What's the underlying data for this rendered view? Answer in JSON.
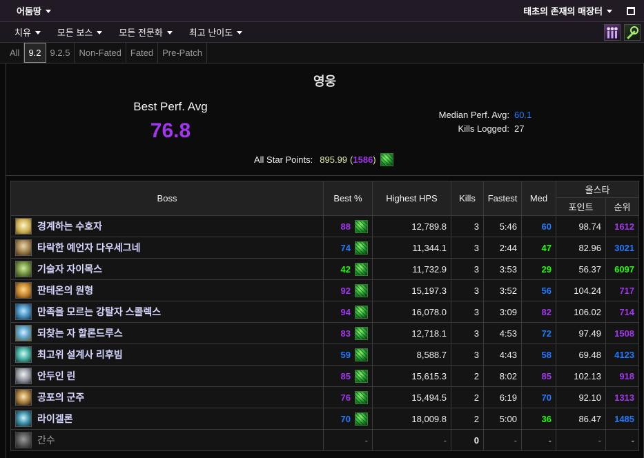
{
  "palette": {
    "epic": "#a335ee",
    "rare": "#1f7bff",
    "uncommon": "#1eff00",
    "common": "#9d9d9d"
  },
  "nav": {
    "expansion": {
      "label": "어둠땅",
      "icon": "caret-down-icon"
    },
    "zone": {
      "label": "태초의 존재의 매장터",
      "icon": "caret-down-icon"
    },
    "window_icon": "expand-icon",
    "filters": [
      {
        "label": "치유",
        "icon": "caret-down-icon"
      },
      {
        "label": "모든 보스",
        "icon": "caret-down-icon"
      },
      {
        "label": "모든 전문화",
        "icon": "caret-down-icon"
      },
      {
        "label": "최고 난이도",
        "icon": "caret-down-icon"
      }
    ],
    "tool_icons": [
      "character-icon",
      "key-icon"
    ]
  },
  "tabs": [
    {
      "label": "All"
    },
    {
      "label": "9.2",
      "active": true
    },
    {
      "label": "9.2.5"
    },
    {
      "label": "Non-Fated"
    },
    {
      "label": "Fated"
    },
    {
      "label": "Pre-Patch"
    }
  ],
  "summary": {
    "difficulty": "영웅",
    "best_perf_label": "Best Perf. Avg",
    "best_perf_value": "76.8",
    "median_label": "Median Perf. Avg:",
    "median_value": "60.1",
    "kills_label": "Kills Logged:",
    "kills_value": "27",
    "allstar_label": "All Star Points:",
    "allstar_points": "895.99",
    "allstar_rank": "1586",
    "allstar_rank_color": "#a335ee",
    "spec_icon": "spec-icon"
  },
  "table": {
    "headers": {
      "boss": "Boss",
      "best": "Best %",
      "hps": "Highest HPS",
      "kills": "Kills",
      "fastest": "Fastest",
      "med": "Med",
      "allstar": "올스타",
      "points": "포인트",
      "rank": "순위"
    },
    "rows": [
      {
        "boss": "경계하는 수호자",
        "best": 88,
        "hps": "12,789.8",
        "kills": "3",
        "fastest": "5:46",
        "med": 60,
        "points": "98.74",
        "rank": "1612",
        "rank_color": "#a335ee"
      },
      {
        "boss": "타락한 예언자 다우세그네",
        "best": 74,
        "hps": "11,344.1",
        "kills": "3",
        "fastest": "2:44",
        "med": 47,
        "points": "82.96",
        "rank": "3021",
        "rank_color": "#1f7bff"
      },
      {
        "boss": "기술자 자이목스",
        "best": 42,
        "hps": "11,732.9",
        "kills": "3",
        "fastest": "3:53",
        "med": 29,
        "points": "56.37",
        "rank": "6097",
        "rank_color": "#1eff00"
      },
      {
        "boss": "판테온의 원형",
        "best": 92,
        "hps": "15,197.3",
        "kills": "3",
        "fastest": "3:52",
        "med": 56,
        "points": "104.24",
        "rank": "717",
        "rank_color": "#a335ee"
      },
      {
        "boss": "만족을 모르는 강탈자 스콜렉스",
        "best": 94,
        "hps": "16,078.0",
        "kills": "3",
        "fastest": "3:09",
        "med": 82,
        "points": "106.02",
        "rank": "714",
        "rank_color": "#a335ee"
      },
      {
        "boss": "되찾는 자 할론드루스",
        "best": 83,
        "hps": "12,718.1",
        "kills": "3",
        "fastest": "4:53",
        "med": 72,
        "points": "97.49",
        "rank": "1508",
        "rank_color": "#a335ee"
      },
      {
        "boss": "최고위 설계사 리후빔",
        "best": 59,
        "hps": "8,588.7",
        "kills": "3",
        "fastest": "4:43",
        "med": 58,
        "points": "69.48",
        "rank": "4123",
        "rank_color": "#1f7bff"
      },
      {
        "boss": "안두인 린",
        "best": 85,
        "hps": "15,615.3",
        "kills": "2",
        "fastest": "8:02",
        "med": 85,
        "points": "102.13",
        "rank": "918",
        "rank_color": "#a335ee"
      },
      {
        "boss": "공포의 군주",
        "best": 76,
        "hps": "15,494.5",
        "kills": "2",
        "fastest": "6:19",
        "med": 70,
        "points": "92.10",
        "rank": "1313",
        "rank_color": "#a335ee"
      },
      {
        "boss": "라이겔론",
        "best": 70,
        "hps": "18,009.8",
        "kills": "2",
        "fastest": "5:00",
        "med": 36,
        "points": "86.47",
        "rank": "1485",
        "rank_color": "#1f7bff"
      },
      {
        "boss": "간수",
        "best": "-",
        "hps": "-",
        "kills": "0",
        "fastest": "-",
        "med": "-",
        "points": "-",
        "rank": "-",
        "rank_color": "#9d9d9d"
      }
    ]
  }
}
